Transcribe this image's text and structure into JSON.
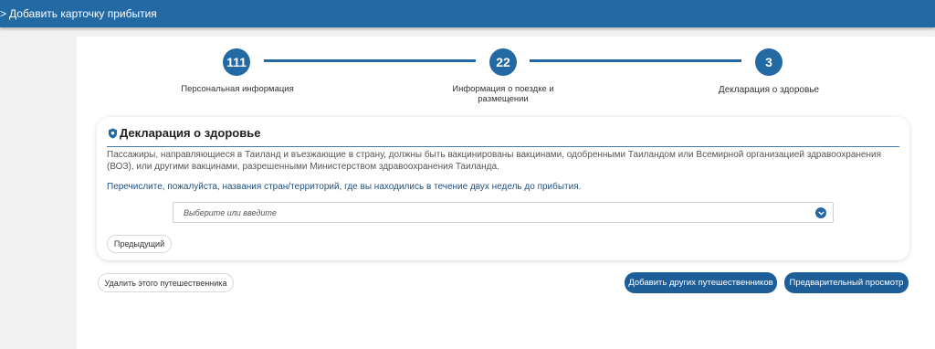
{
  "header": {
    "back_glyph": ">",
    "title": "Добавить карточку прибытия"
  },
  "stepper": {
    "steps": [
      {
        "number": "111",
        "label": "Персональная информация"
      },
      {
        "number": "22",
        "label": "Информация о поездке и размещении"
      },
      {
        "number": "3",
        "label": "Декларация о здоровье"
      }
    ]
  },
  "health": {
    "title": "Декларация о здоровье",
    "intro": "Пассажиры, направляющиеся в Таиланд и въезжающие в страну, должны быть вакцинированы вакцинами, одобренными Таиландом или Всемирной организацией здравоохранения (ВОЗ), или другими вакцинами, разрешенными Министерством здравоохранения Таиланда.",
    "question": "Перечислите, пожалуйста, названия стран/территорий, где вы находились в течение двух недель до прибытия.",
    "select_placeholder": "Выберите или введите",
    "prev_label": "Предыдущий"
  },
  "actions": {
    "delete_label": "Удалить этого путешественника",
    "add_label": "Добавить других путешественников",
    "preview_label": "Предварительный просмотр"
  },
  "colors": {
    "primary": "#236aa5",
    "button_primary": "#1e5e98"
  },
  "icons": {
    "back": "chevron-right-icon",
    "title": "shield-icon",
    "select": "chevron-down-icon"
  }
}
